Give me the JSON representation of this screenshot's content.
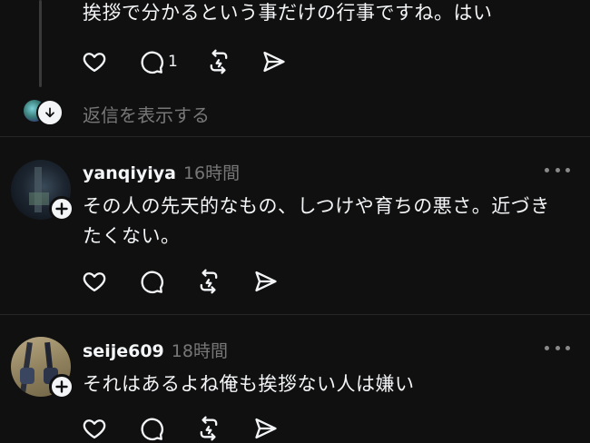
{
  "top_post": {
    "text": "挨拶で分かるという事だけの行事ですね。はい",
    "reply_count": "1",
    "show_replies_label": "返信を表示する"
  },
  "posts": [
    {
      "username": "yanqiyiya",
      "time": "16時間",
      "text_line1": "その人の先天的なもの、しつけや育ちの悪さ。近づき",
      "text_line2": "たくない。"
    },
    {
      "username": "seije609",
      "time": "18時間",
      "text_line1": "それはあるよね俺も挨拶ない人は嫌い"
    }
  ],
  "colors": {
    "background": "#101010",
    "text": "#f3f5f7",
    "muted": "#777777",
    "divider": "#262626"
  },
  "icons": [
    "heart-icon",
    "comment-icon",
    "repost-icon",
    "share-icon",
    "more-icon",
    "follow-plus-icon",
    "arrow-down-icon"
  ]
}
